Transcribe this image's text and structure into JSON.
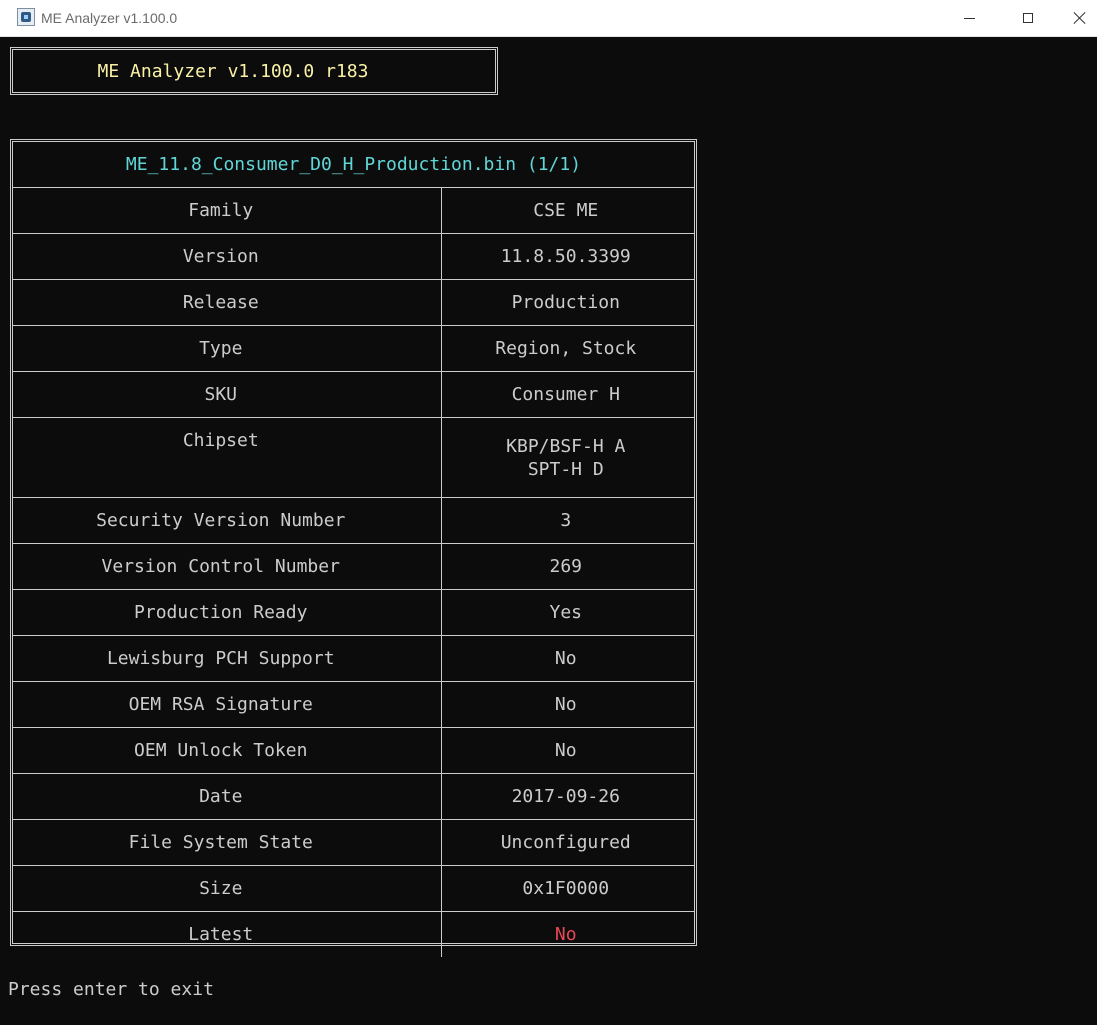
{
  "window": {
    "title": "ME Analyzer v1.100.0"
  },
  "console": {
    "header_title": "ME Analyzer v1.100.0 r183",
    "file_title": "ME_11.8_Consumer_D0_H_Production.bin (1/1)",
    "rows": [
      {
        "label": "Family",
        "value": "CSE ME"
      },
      {
        "label": "Version",
        "value": "11.8.50.3399"
      },
      {
        "label": "Release",
        "value": "Production"
      },
      {
        "label": "Type",
        "value": "Region, Stock"
      },
      {
        "label": "SKU",
        "value": "Consumer H"
      },
      {
        "label": "Chipset",
        "value_lines": [
          "KBP/BSF-H A",
          "SPT-H D"
        ]
      },
      {
        "label": "Security Version Number",
        "value": "3"
      },
      {
        "label": "Version Control Number",
        "value": "269"
      },
      {
        "label": "Production Ready",
        "value": "Yes"
      },
      {
        "label": "Lewisburg PCH Support",
        "value": "No"
      },
      {
        "label": "OEM RSA Signature",
        "value": "No"
      },
      {
        "label": "OEM Unlock Token",
        "value": "No"
      },
      {
        "label": "Date",
        "value": "2017-09-26"
      },
      {
        "label": "File System State",
        "value": "Unconfigured"
      },
      {
        "label": "Size",
        "value": "0x1F0000"
      },
      {
        "label": "Latest",
        "value": "No"
      }
    ],
    "prompt": "Press enter to exit"
  },
  "colors": {
    "background": "#0c0c0c",
    "text": "#cccccc",
    "header_title": "#f9f1a5",
    "file_title": "#61d6d6",
    "latest_no": "#e74856"
  },
  "icons": {
    "app": "me-analyzer-app-icon",
    "minimize": "minimize-icon",
    "maximize": "maximize-icon",
    "close": "close-icon"
  }
}
